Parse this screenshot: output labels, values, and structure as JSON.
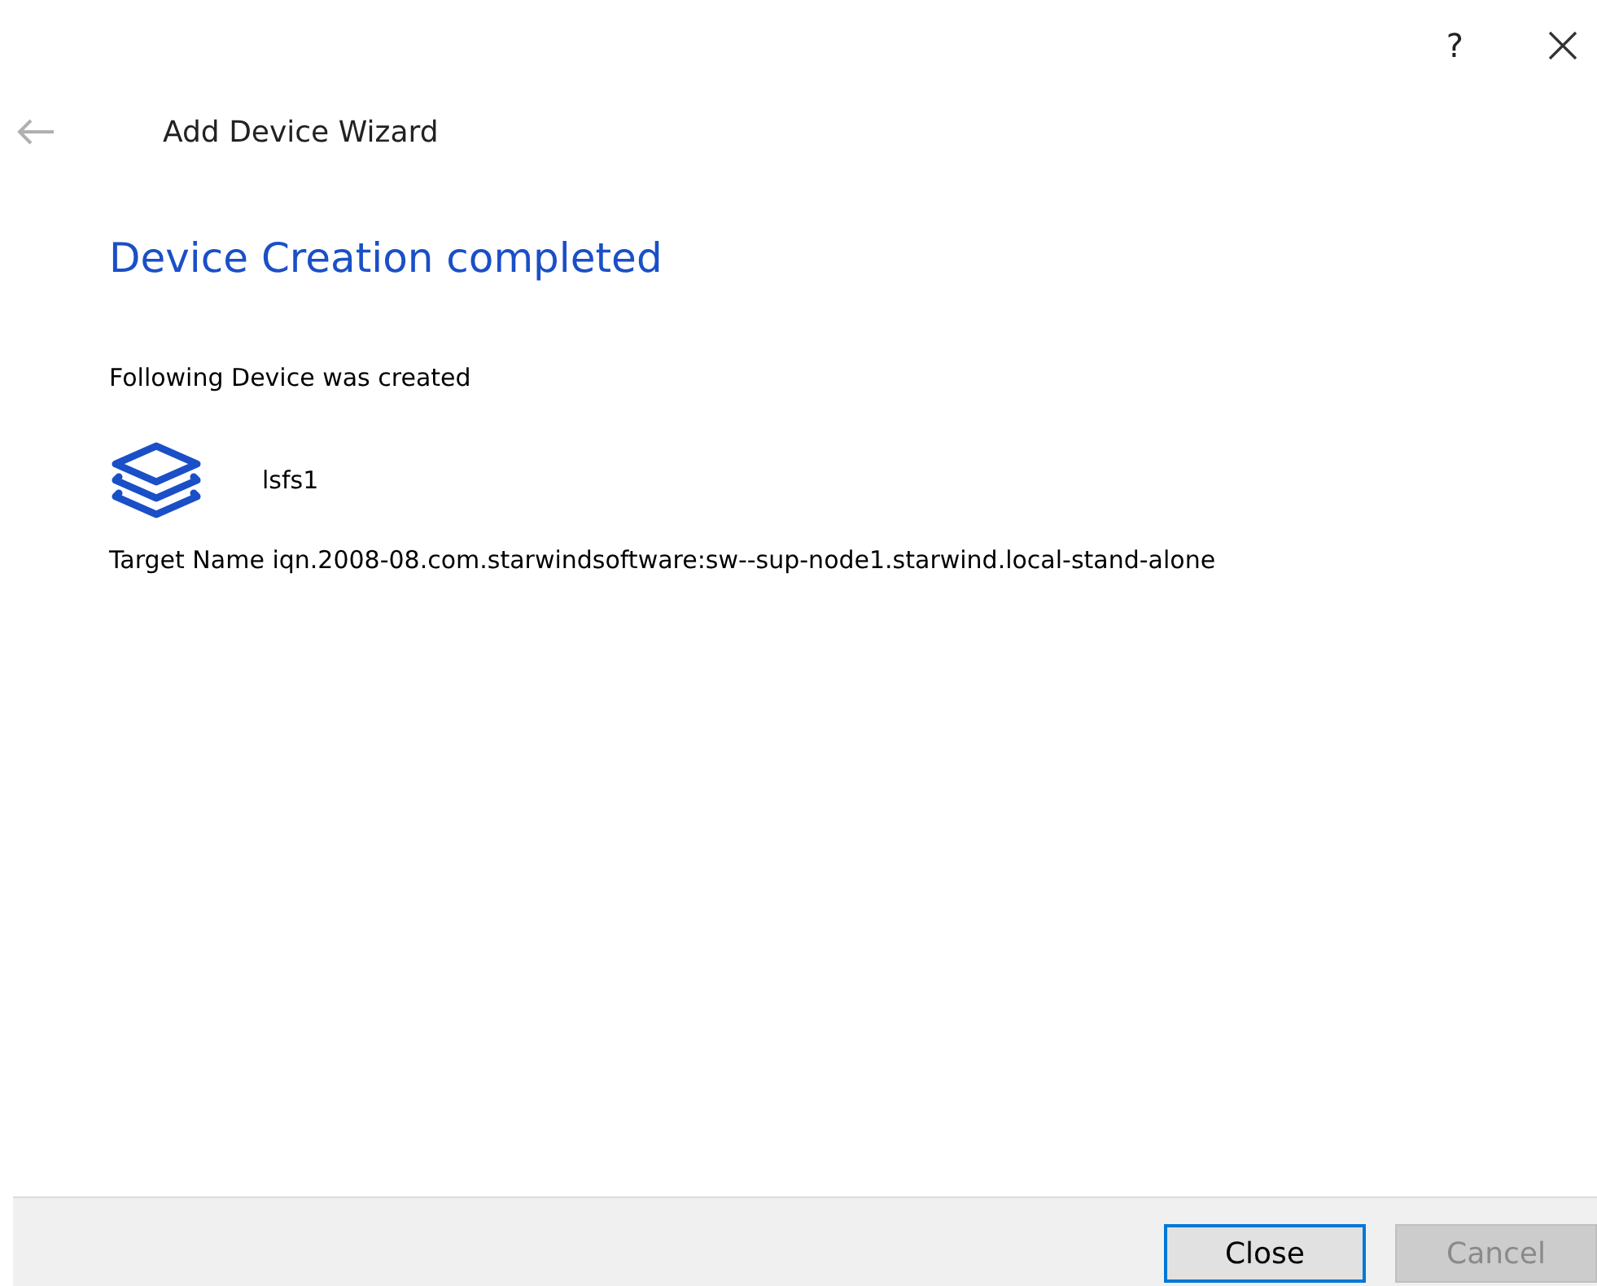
{
  "window": {
    "help": "?"
  },
  "header": {
    "back_disabled": true,
    "title": "Add Device Wizard"
  },
  "heading": "Device Creation completed",
  "intro": "Following Device was created",
  "device": {
    "name": "lsfs1"
  },
  "target": "Target Name iqn.2008-08.com.starwindsoftware:sw--sup-node1.starwind.local-stand-alone",
  "buttons": [
    {
      "label": "Close",
      "focused": true,
      "disabled": false
    },
    {
      "label": "Cancel",
      "focused": false,
      "disabled": true
    }
  ]
}
